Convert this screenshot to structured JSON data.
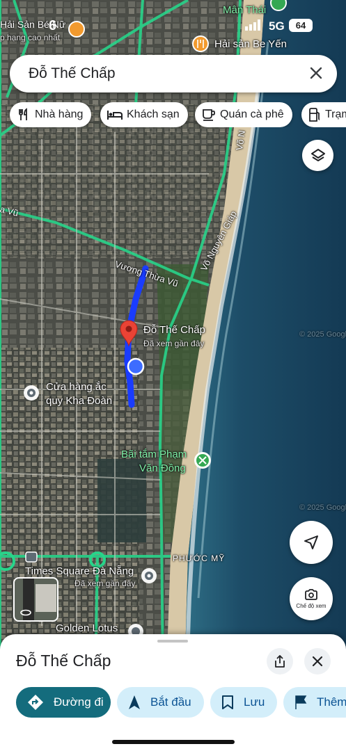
{
  "status_bar": {
    "time": "6",
    "network": "5G",
    "battery": "64"
  },
  "search": {
    "query": "Đỗ Thế Chấp"
  },
  "chips": [
    {
      "label": "Nhà hàng",
      "icon": "fork-knife-icon"
    },
    {
      "label": "Khách sạn",
      "icon": "bed-icon"
    },
    {
      "label": "Quán cà phê",
      "icon": "coffee-cup-icon"
    },
    {
      "label": "Trạm",
      "icon": "fuel-pump-icon"
    }
  ],
  "map": {
    "places": {
      "top_left": "Hải Sản Bé Nữ",
      "top_left_sub": "p hạng cao nhất",
      "man_thai": "Mân Thái",
      "hai_san_be_yen": "Hải sản Be Yến",
      "destination": "Đỗ Thế Chấp",
      "destination_sub": "Đã xem gần đây",
      "shop_line1": "Cửa hàng ắc",
      "shop_line2": "quy Kha Đoàn",
      "beach_line1": "Bãi tắm Phạm",
      "beach_line2": "Văn Đồng",
      "times_square": "Times Square Đà Nẵng",
      "times_square_sub": "Đã xem gần đây",
      "golden_lotus": "Golden Lotus",
      "phuoc_my": "PHƯỚC MỸ"
    },
    "roads": {
      "vuong_thua_vu": "Vương Thừa Vũ",
      "vo_nguyen_giap": "Võ Nguyên Giáp",
      "left_road": "a Vũ",
      "top_road": "Võ N"
    },
    "watermark_1": "© 2025 Google",
    "watermark_2": "© 2025 Google",
    "streetview_label": "Chế độ xem",
    "colors": {
      "route": "#1a3cff",
      "pin": "#ea4335",
      "green_label": "#7ff0a8"
    }
  },
  "sheet": {
    "title": "Đỗ Thế Chấp",
    "actions": [
      {
        "label": "Đường đi",
        "icon": "directions-icon"
      },
      {
        "label": "Bắt đầu",
        "icon": "navigation-arrow-icon"
      },
      {
        "label": "Lưu",
        "icon": "bookmark-icon"
      },
      {
        "label": "Thêm",
        "icon": "flag-icon"
      }
    ]
  }
}
